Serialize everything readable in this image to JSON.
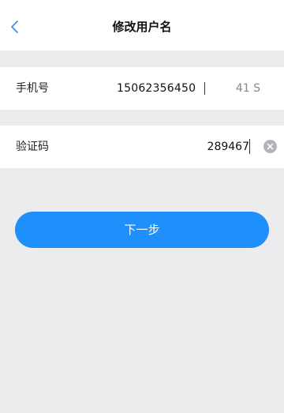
{
  "header": {
    "title": "修改用户名",
    "back_icon": "chevron-left-icon"
  },
  "form": {
    "phone_label": "手机号",
    "phone_value": "15062356450",
    "countdown": "41 S",
    "code_label": "验证码",
    "code_value": "289467",
    "clear_icon": "clear-circle-icon"
  },
  "actions": {
    "next_label": "下一步"
  },
  "colors": {
    "accent": "#1f8ffb",
    "background": "#ececef",
    "back_icon": "#2e8ef5"
  }
}
